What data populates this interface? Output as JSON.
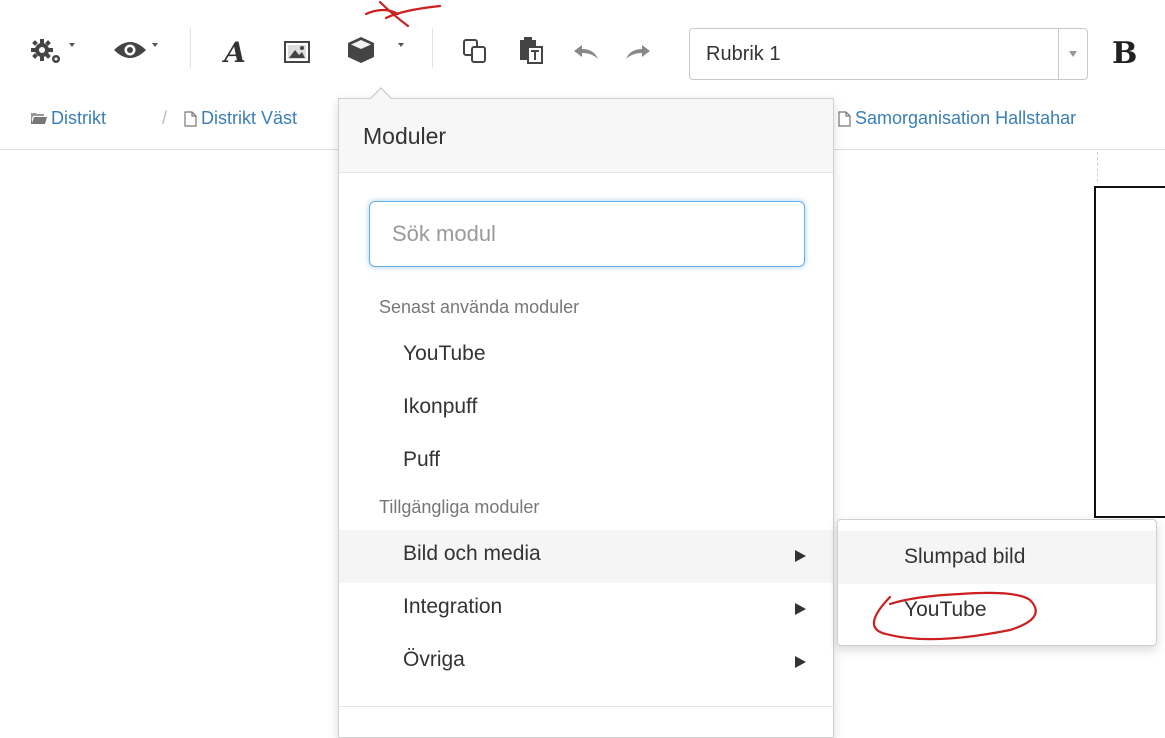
{
  "toolbar": {
    "heading_select_value": "Rubrik 1",
    "bold_label": "B",
    "italic_label": "A"
  },
  "breadcrumb": {
    "items": [
      {
        "label": "Distrikt",
        "icon": "folder-icon"
      },
      {
        "label": "Distrikt Väst",
        "icon": "page-icon"
      },
      {
        "label": "Samorganisation Hallstahar",
        "icon": "page-icon"
      }
    ],
    "separator": "/"
  },
  "dropdown": {
    "title": "Moduler",
    "search_placeholder": "Sök modul",
    "recent_header": "Senast använda moduler",
    "recent_items": [
      "YouTube",
      "Ikonpuff",
      "Puff"
    ],
    "available_header": "Tillgängliga moduler",
    "available_items": [
      "Bild och media",
      "Integration",
      "Övriga"
    ]
  },
  "submenu": {
    "items": [
      "Slumpad bild",
      "YouTube"
    ]
  },
  "colors": {
    "link": "#3a7eb8",
    "focus": "#66afe9",
    "annotation": "#cc1f1f"
  }
}
